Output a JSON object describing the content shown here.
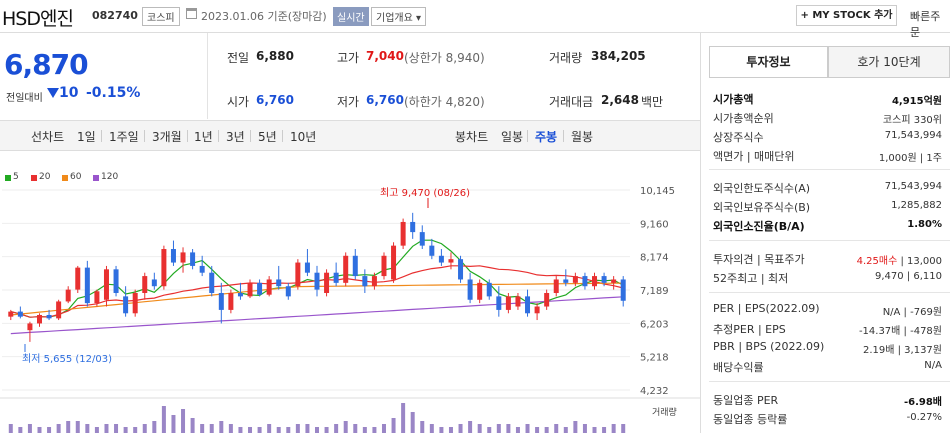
{
  "header": {
    "company": "HSD엔진",
    "code": "082740",
    "market": "코스피",
    "date": "2023.01.06 기준(장마감)",
    "realtime": "실시간",
    "company_info": "기업개요 ▾",
    "my_stock": "+ MY STOCK 추가",
    "quick_order": "빠른주문"
  },
  "price": {
    "current": "6,870",
    "change_label": "전일대비",
    "change_value": "10",
    "change_pct": "-0.15%"
  },
  "stats": {
    "prev_close_label": "전일",
    "prev_close": "6,880",
    "high_label": "고가",
    "high": "7,040",
    "upper_limit": "(상한가 8,940)",
    "volume_label": "거래량",
    "volume": "384,205",
    "open_label": "시가",
    "open": "6,760",
    "low_label": "저가",
    "low": "6,760",
    "lower_limit": "(하한가 4,820)",
    "amount_label": "거래대금",
    "amount": "2,648",
    "amount_unit": "백만"
  },
  "period": {
    "line_label": "선차트",
    "line_items": [
      "1일",
      "1주일",
      "3개월",
      "1년",
      "3년",
      "5년",
      "10년"
    ],
    "candle_label": "봉차트",
    "candle_items": [
      "일봉",
      "주봉",
      "월봉"
    ],
    "active_candle": "주봉"
  },
  "legend": [
    {
      "label": "5",
      "color": "#22aa22"
    },
    {
      "label": "20",
      "color": "#e83030"
    },
    {
      "label": "60",
      "color": "#f08a1a"
    },
    {
      "label": "120",
      "color": "#9955cc"
    }
  ],
  "chart_data": {
    "type": "candlestick",
    "y_ticks": [
      "10,145",
      "9,160",
      "8,174",
      "7,189",
      "6,203",
      "5,218",
      "4,232"
    ],
    "y_range": [
      4232,
      10145
    ],
    "high_annotation": "최고 9,470 (08/26)",
    "low_annotation": "최저 5,655 (12/03)",
    "volume_label": "거래량",
    "candles": [
      [
        6400,
        6600,
        6300,
        6550
      ],
      [
        6550,
        6700,
        6350,
        6400
      ],
      [
        6000,
        6250,
        5655,
        6200
      ],
      [
        6200,
        6500,
        6100,
        6450
      ],
      [
        6450,
        6600,
        6300,
        6350
      ],
      [
        6350,
        6900,
        6300,
        6850
      ],
      [
        6850,
        7300,
        6800,
        7200
      ],
      [
        7200,
        7900,
        7100,
        7850
      ],
      [
        7850,
        8050,
        6700,
        6800
      ],
      [
        6800,
        7200,
        6700,
        7150
      ],
      [
        6900,
        7900,
        6700,
        7800
      ],
      [
        7800,
        7900,
        7000,
        7100
      ],
      [
        7000,
        7300,
        6400,
        6500
      ],
      [
        6500,
        7200,
        6400,
        7100
      ],
      [
        7100,
        7700,
        6900,
        7600
      ],
      [
        7500,
        7700,
        7200,
        7300
      ],
      [
        7300,
        8500,
        7200,
        8400
      ],
      [
        8400,
        8650,
        7900,
        8000
      ],
      [
        8000,
        8450,
        7700,
        8300
      ],
      [
        8300,
        8400,
        7800,
        7900
      ],
      [
        7900,
        8200,
        7600,
        7700
      ],
      [
        7700,
        7900,
        7000,
        7100
      ],
      [
        7100,
        7400,
        6200,
        6600
      ],
      [
        6600,
        7200,
        6500,
        7100
      ],
      [
        7100,
        7400,
        6900,
        7000
      ],
      [
        7000,
        7500,
        6950,
        7400
      ],
      [
        7400,
        7500,
        7000,
        7050
      ],
      [
        7050,
        7600,
        7000,
        7500
      ],
      [
        7500,
        7900,
        7200,
        7300
      ],
      [
        7300,
        7400,
        6900,
        7000
      ],
      [
        7300,
        8100,
        7200,
        8000
      ],
      [
        8000,
        8400,
        7600,
        7700
      ],
      [
        7700,
        7900,
        7000,
        7200
      ],
      [
        7100,
        7800,
        7000,
        7700
      ],
      [
        7700,
        8000,
        7300,
        7400
      ],
      [
        7400,
        8300,
        7300,
        8200
      ],
      [
        8200,
        8400,
        7500,
        7600
      ],
      [
        7600,
        7800,
        7100,
        7300
      ],
      [
        7300,
        7700,
        7200,
        7600
      ],
      [
        7600,
        8300,
        7500,
        8200
      ],
      [
        7500,
        8600,
        7400,
        8500
      ],
      [
        8500,
        9300,
        8400,
        9200
      ],
      [
        9200,
        9470,
        8700,
        8900
      ],
      [
        8900,
        9100,
        8400,
        8500
      ],
      [
        8500,
        8700,
        8100,
        8200
      ],
      [
        8200,
        8400,
        7900,
        8000
      ],
      [
        8000,
        8300,
        7800,
        8100
      ],
      [
        8100,
        8200,
        7400,
        7500
      ],
      [
        7500,
        7700,
        6800,
        6900
      ],
      [
        6900,
        7500,
        6800,
        7400
      ],
      [
        7400,
        7500,
        6900,
        7000
      ],
      [
        7000,
        7300,
        6400,
        6600
      ],
      [
        6600,
        7100,
        6500,
        7000
      ],
      [
        6700,
        7100,
        6600,
        7000
      ],
      [
        7000,
        7200,
        6400,
        6500
      ],
      [
        6500,
        6800,
        6300,
        6700
      ],
      [
        6700,
        7200,
        6600,
        7100
      ],
      [
        7100,
        7600,
        7000,
        7500
      ],
      [
        7500,
        7800,
        7300,
        7400
      ],
      [
        7400,
        7700,
        7300,
        7600
      ],
      [
        7600,
        7700,
        7200,
        7300
      ],
      [
        7300,
        7700,
        7200,
        7600
      ],
      [
        7600,
        7700,
        7300,
        7400
      ],
      [
        7400,
        7600,
        7200,
        7500
      ],
      [
        7500,
        7600,
        6700,
        6870
      ]
    ],
    "volumes": [
      3,
      2,
      3,
      2,
      2,
      3,
      4,
      4,
      3,
      2,
      3,
      3,
      2,
      2,
      3,
      4,
      9,
      6,
      8,
      5,
      3,
      3,
      4,
      3,
      2,
      2,
      2,
      3,
      2,
      2,
      3,
      3,
      2,
      2,
      3,
      4,
      3,
      2,
      2,
      3,
      5,
      10,
      7,
      4,
      3,
      2,
      2,
      3,
      4,
      3,
      2,
      3,
      3,
      2,
      3,
      2,
      2,
      3,
      2,
      4,
      3,
      2,
      2,
      3,
      3
    ]
  },
  "right": {
    "tab_active": "투자정보",
    "tab_other": "호가 10단계",
    "rows1": [
      {
        "label": "시가총액",
        "value": "4,915억원",
        "bold": true
      },
      {
        "label": "시가총액순위",
        "value": "코스피 330위"
      },
      {
        "label": "상장주식수",
        "value": "71,543,994"
      },
      {
        "label": "액면가 | 매매단위",
        "value": "1,000원 | 1주"
      }
    ],
    "rows2": [
      {
        "label": "외국인한도주식수(A)",
        "value": "71,543,994"
      },
      {
        "label": "외국인보유주식수(B)",
        "value": "1,285,882"
      },
      {
        "label": "외국인소진율(B/A)",
        "value": "1.80%",
        "bold": true
      }
    ],
    "rows3": [
      {
        "label": "투자의견 | 목표주가",
        "value_red": "4.25매수",
        "value": " | 13,000"
      },
      {
        "label": "52주최고 | 최저",
        "value": "9,470 | 6,110"
      }
    ],
    "rows4": [
      {
        "label": "PER | EPS(2022.09)",
        "value": "N/A | -769원"
      },
      {
        "label": "추정PER | EPS",
        "value": "-14.37배 | -478원"
      },
      {
        "label": "PBR | BPS (2022.09)",
        "value": "2.19배 | 3,137원"
      },
      {
        "label": "배당수익률",
        "value": "N/A"
      }
    ],
    "rows5": [
      {
        "label": "동일업종 PER",
        "value": "-6.98배",
        "bold": true
      },
      {
        "label": "동일업종 등락률",
        "value": "-0.27%",
        "blue": true
      }
    ]
  }
}
